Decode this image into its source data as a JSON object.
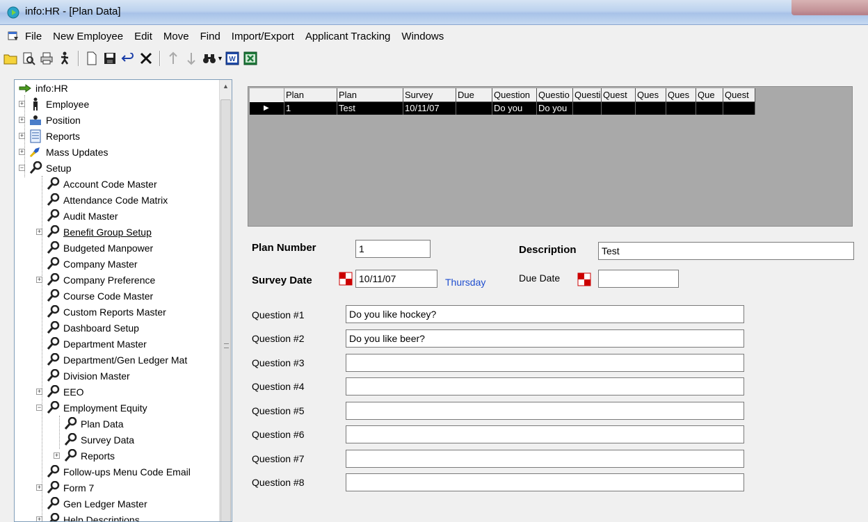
{
  "window": {
    "title": "info:HR - [Plan Data]"
  },
  "menu": [
    "File",
    "New Employee",
    "Edit",
    "Move",
    "Find",
    "Import/Export",
    "Applicant Tracking",
    "Windows"
  ],
  "toolbar": [
    "folder-icon",
    "print-preview-icon",
    "print-icon",
    "run-icon",
    "new-doc-icon",
    "save-icon",
    "undo-icon",
    "delete-icon",
    "arrow-up-icon",
    "arrow-down-icon",
    "binoculars-icon",
    "word-icon",
    "excel-icon"
  ],
  "tree": {
    "root": "info:HR",
    "items": [
      "Employee",
      "Position",
      "Reports",
      "Mass Updates",
      "Setup",
      "Account Code Master",
      "Attendance Code Matrix",
      "Audit Master",
      "Benefit Group Setup",
      "Budgeted Manpower",
      "Company Master",
      "Company Preference",
      "Course Code Master",
      "Custom Reports Master",
      "Dashboard Setup",
      "Department Master",
      "Department/Gen Ledger Mat",
      "Division Master",
      "EEO",
      "Employment Equity",
      "Plan Data",
      "Survey Data",
      "Reports",
      "Follow-ups Menu Code Email",
      "Form 7",
      "Gen Ledger Master",
      "Help Descriptions"
    ]
  },
  "grid": {
    "headers": [
      "Plan",
      "Plan",
      "Survey",
      "Due",
      "Question",
      "Questio",
      "Questi",
      "Quest",
      "Ques",
      "Ques",
      "Que",
      "Quest"
    ],
    "row": [
      "1",
      "Test",
      "10/11/07",
      "",
      "Do you",
      "Do you",
      "",
      "",
      "",
      "",
      "",
      ""
    ],
    "row_marker": "▶"
  },
  "form": {
    "plan_number_label": "Plan Number",
    "plan_number": "1",
    "description_label": "Description",
    "description": "Test",
    "survey_date_label": "Survey Date",
    "survey_date": "10/11/07",
    "survey_weekday": "Thursday",
    "due_date_label": "Due Date",
    "due_date": "",
    "questions": [
      {
        "label": "Question #1",
        "value": "Do you like hockey?"
      },
      {
        "label": "Question #2",
        "value": "Do you like beer?"
      },
      {
        "label": "Question #3",
        "value": ""
      },
      {
        "label": "Question #4",
        "value": ""
      },
      {
        "label": "Question #5",
        "value": ""
      },
      {
        "label": "Question #6",
        "value": ""
      },
      {
        "label": "Question #7",
        "value": ""
      },
      {
        "label": "Question #8",
        "value": ""
      }
    ]
  },
  "colors": {
    "weekday": "#1f4ecf",
    "grid_selected": "#000000",
    "grid_bg": "#a9a9a9"
  }
}
